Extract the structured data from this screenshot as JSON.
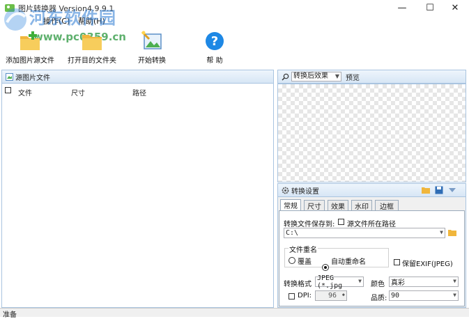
{
  "window": {
    "title": "图片转换器 Version4.9.9.1",
    "minimize_glyph": "—",
    "maximize_glyph": "☐",
    "close_glyph": "✕"
  },
  "watermark": {
    "line1": "河东软件园",
    "line2": "www.pc0359.cn"
  },
  "menu": {
    "items": [
      {
        "label": "操作(C)"
      },
      {
        "label": "帮助(H)"
      }
    ]
  },
  "toolbar": {
    "add_label": "添加图片源文件",
    "open_folder_label": "打开目的文件夹",
    "start_label": "开始转换",
    "help_label": "帮 助"
  },
  "left_panel": {
    "title": "源图片文件",
    "columns": [
      "文件",
      "尺寸",
      "路径"
    ]
  },
  "right_panel": {
    "view_select": "转换后效果",
    "preview_label": "预览"
  },
  "settings": {
    "title": "转换设置",
    "tabs": [
      "常规",
      "尺寸",
      "效果",
      "水印",
      "边框"
    ],
    "save_to_label": "转换文件保存到:",
    "source_path_label": "源文件所在路径",
    "save_path": "C:\\",
    "rename_group": "文件重名",
    "overwrite_label": "覆盖",
    "auto_rename_label": "自动重命名",
    "keep_exif_label": "保留EXIF(JPEG)",
    "format_label": "转换格式",
    "format_value": "JPEG (*.jpg",
    "color_label": "颜色",
    "color_value": "真彩",
    "dpi_label": "DPI:",
    "dpi_value": "96",
    "quality_label": "品质:",
    "quality_value": "90"
  },
  "status": {
    "text": "准备"
  },
  "colors": {
    "accent": "#a9c4e0",
    "folder": "#f0b63c",
    "help_blue": "#1e88e5"
  }
}
